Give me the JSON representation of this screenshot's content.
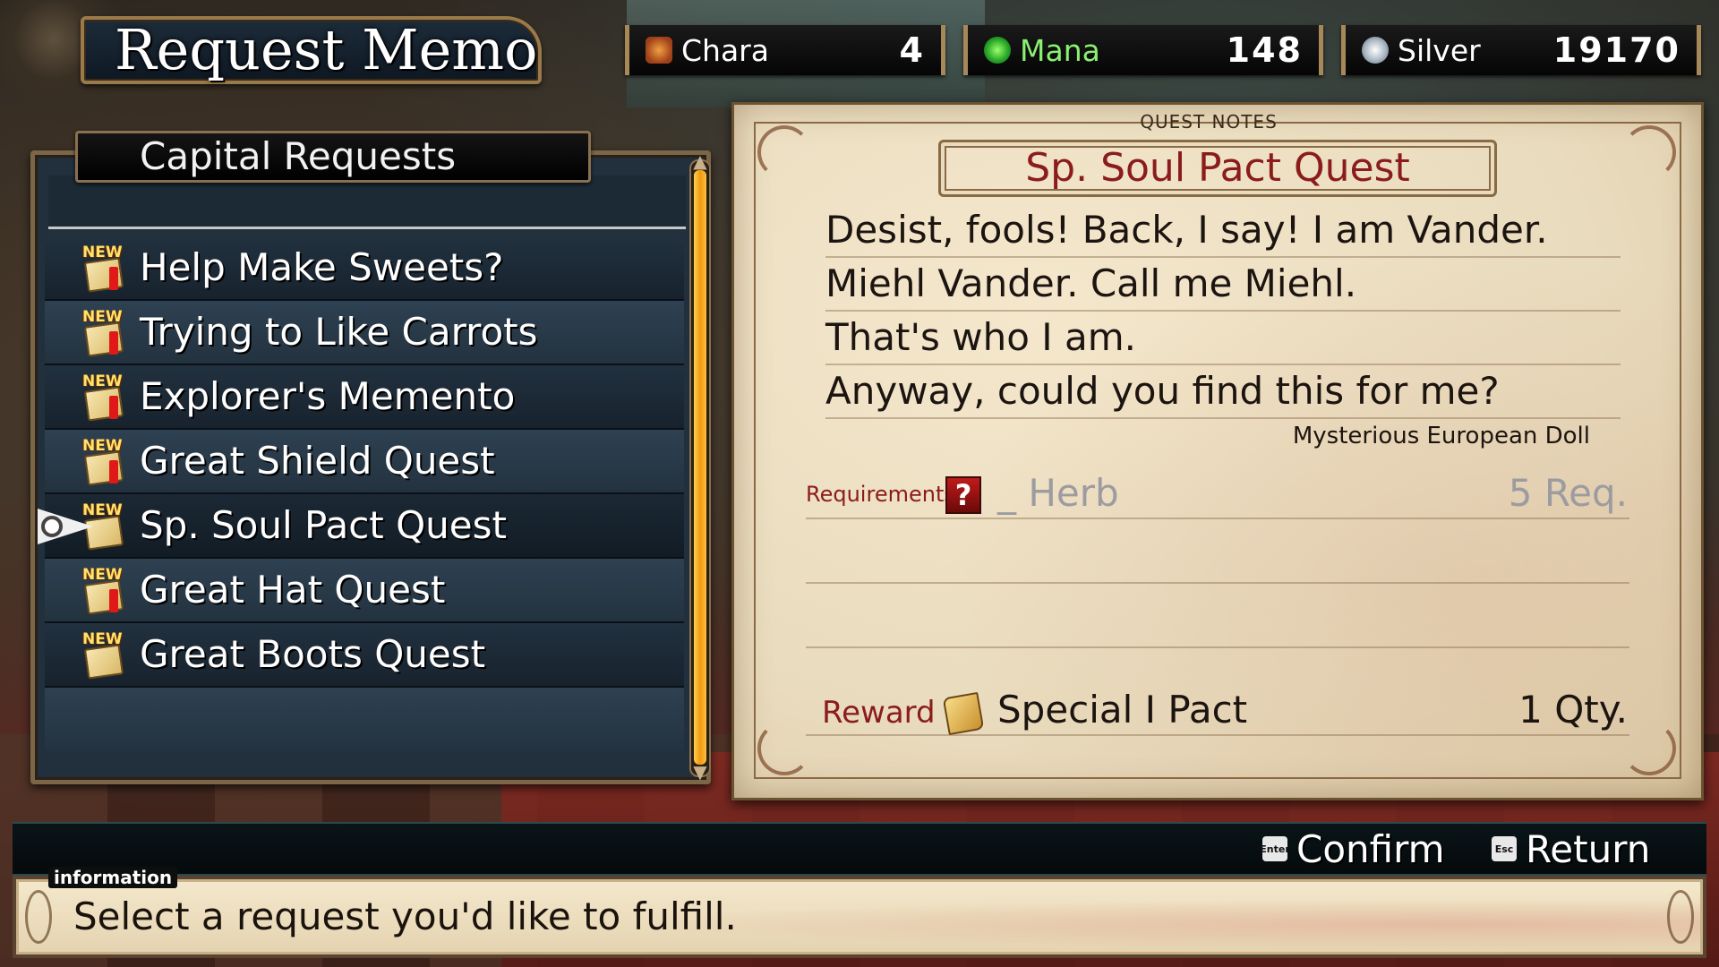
{
  "screen_title": "Request Memo",
  "stats": {
    "chara": {
      "label": "Chara",
      "value": "4",
      "icon": "character-icon"
    },
    "mana": {
      "label": "Mana",
      "value": "148",
      "icon": "mana-orb-icon"
    },
    "silver": {
      "label": "Silver",
      "value": "19170",
      "icon": "silver-coin-icon"
    }
  },
  "request_list": {
    "header": "Capital Requests",
    "badge_text": "NEW",
    "items": [
      {
        "label": "Help Make Sweets?",
        "is_new": true
      },
      {
        "label": "Trying to Like Carrots",
        "is_new": true
      },
      {
        "label": "Explorer's Memento",
        "is_new": true
      },
      {
        "label": "Great Shield Quest",
        "is_new": true
      },
      {
        "label": "Sp. Soul Pact Quest",
        "is_new": true,
        "selected": true
      },
      {
        "label": "Great Hat Quest",
        "is_new": true
      },
      {
        "label": "Great Boots Quest",
        "is_new": true
      }
    ]
  },
  "quest_notes": {
    "section_label": "QUEST NOTES",
    "title": "Sp. Soul Pact Quest",
    "lines": [
      "Desist, fools!  Back, I say!  I am Vander.",
      "Miehl Vander. Call me Miehl.",
      "That's who I am.",
      "Anyway, could you find this for me?"
    ],
    "requester": "Mysterious European Doll",
    "requirements": {
      "label": "Requirements",
      "icon_glyph": "?",
      "item": "_ Herb",
      "quantity": "5 Req."
    },
    "reward": {
      "label": "Reward",
      "item": "Special I Pact",
      "quantity": "1 Qty."
    }
  },
  "controls": {
    "confirm": {
      "key": "Enter",
      "label": "Confirm"
    },
    "return": {
      "key": "Esc",
      "label": "Return"
    }
  },
  "information": {
    "tab_label": "information",
    "text": "Select a request you'd like to fulfill."
  },
  "colors": {
    "accent_red": "#8a1c1c",
    "mana_green": "#8af070",
    "scroll_gold": "#f09a10"
  }
}
